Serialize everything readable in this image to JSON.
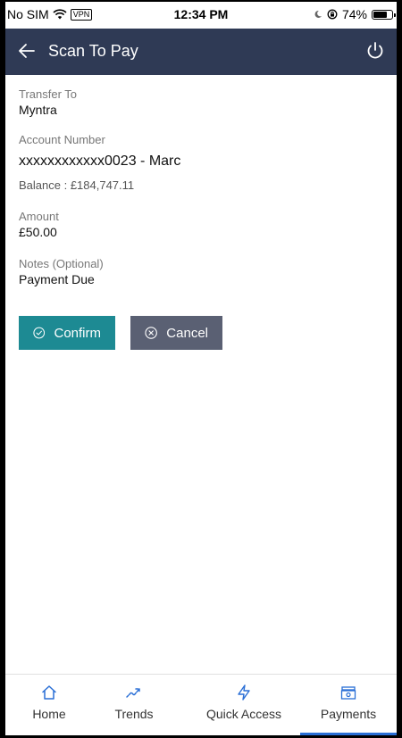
{
  "status_bar": {
    "carrier": "No SIM",
    "vpn": "VPN",
    "time": "12:34 PM",
    "battery": "74%",
    "battery_level": 0.74
  },
  "header": {
    "title": "Scan To Pay",
    "back_icon": "back-arrow-icon",
    "logout_icon": "power-icon"
  },
  "form": {
    "transfer_to_label": "Transfer To",
    "transfer_to_value": "Myntra",
    "account_label": "Account Number",
    "account_value": "xxxxxxxxxxxx0023 - Marc",
    "balance": "Balance : £184,747.11",
    "amount_label": "Amount",
    "amount_value": "£50.00",
    "notes_label": "Notes (Optional)",
    "notes_value": "Payment Due"
  },
  "actions": {
    "confirm_label": "Confirm",
    "cancel_label": "Cancel",
    "confirm_color": "#1d8a93",
    "cancel_color": "#5a6073"
  },
  "nav": {
    "items": [
      {
        "label": "Home",
        "icon": "home-icon"
      },
      {
        "label": "Trends",
        "icon": "trends-icon"
      },
      {
        "label": "Quick Access",
        "icon": "lightning-icon"
      },
      {
        "label": "Payments",
        "icon": "payments-icon"
      }
    ],
    "active": "Payments",
    "accent_color": "#2a6fd6"
  },
  "colors": {
    "header_bg": "#2f3a55",
    "icon_blue": "#2a6fd6"
  }
}
